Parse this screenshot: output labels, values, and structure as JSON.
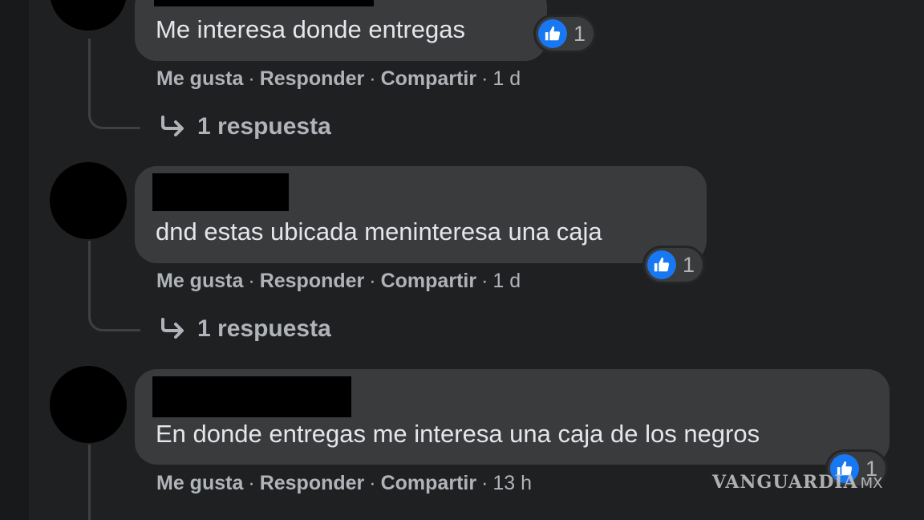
{
  "comments": [
    {
      "text": "Me interesa donde entregas",
      "reaction_count": "1",
      "time": "1 d",
      "replies_label": "1 respuesta"
    },
    {
      "text": "dnd estas ubicada meninteresa una caja",
      "reaction_count": "1",
      "time": "1 d",
      "replies_label": "1 respuesta"
    },
    {
      "text": "En donde entregas me interesa una caja de los negros",
      "reaction_count": "1",
      "time": "13 h"
    }
  ],
  "actions": {
    "like": "Me gusta",
    "reply": "Responder",
    "share": "Compartir",
    "separator": "·"
  },
  "icons": {
    "reaction": "like-thumbs-up-icon",
    "replies": "reply-arrow-icon"
  },
  "colors": {
    "background": "#1f2022",
    "bubble": "#3a3b3c",
    "like_blue": "#1877f2",
    "text_primary": "#e4e6eb",
    "text_secondary": "#b0b3b8"
  },
  "watermark": {
    "main": "VANGUARDIA",
    "sub": "MX"
  }
}
